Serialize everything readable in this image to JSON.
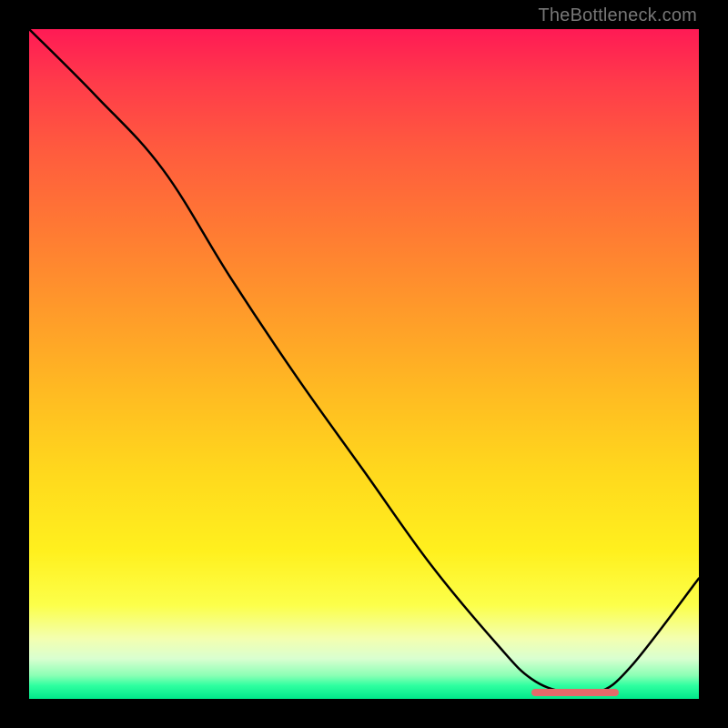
{
  "watermark_text": "TheBottleneck.com",
  "chart_data": {
    "type": "line",
    "title": "",
    "xlabel": "",
    "ylabel": "",
    "xlim": [
      0,
      100
    ],
    "ylim": [
      0,
      100
    ],
    "grid": false,
    "legend": false,
    "series": [
      {
        "name": "bottleneck-curve",
        "x": [
          0,
          10,
          20,
          30,
          40,
          50,
          60,
          70,
          75,
          80,
          85,
          90,
          100
        ],
        "values": [
          100,
          90,
          79,
          63,
          48,
          34,
          20,
          8,
          3,
          1,
          1,
          5,
          18
        ]
      }
    ],
    "marker": {
      "name": "optimal-range",
      "x_start": 75,
      "x_end": 88,
      "y": 1
    },
    "background": "rainbow-vertical-gradient"
  },
  "colors": {
    "curve": "#000000",
    "marker": "#e46a6a",
    "page_bg": "#000000"
  }
}
